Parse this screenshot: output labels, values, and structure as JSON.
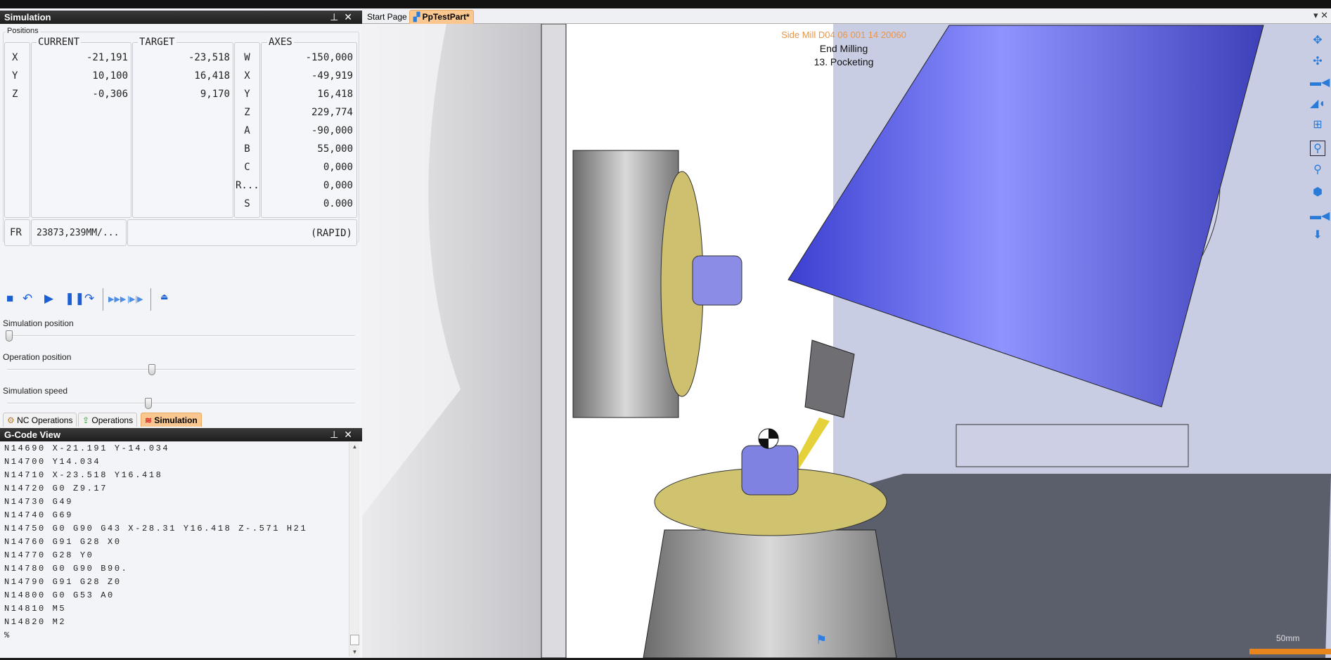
{
  "simulation_panel": {
    "title": "Simulation",
    "pin_icon": "pin-icon",
    "close_icon": "close-icon",
    "positions_label": "Positions",
    "current_header": "CURRENT",
    "target_header": "TARGET",
    "axes_header": "AXES",
    "rows": [
      {
        "axis": "X",
        "current": "-21,191",
        "target": "-23,518"
      },
      {
        "axis": "Y",
        "current": "10,100",
        "target": "16,418"
      },
      {
        "axis": "Z",
        "current": "-0,306",
        "target": "9,170"
      }
    ],
    "machine_axes": [
      {
        "axis": "W",
        "value": "-150,000"
      },
      {
        "axis": "X",
        "value": "-49,919"
      },
      {
        "axis": "Y",
        "value": "16,418"
      },
      {
        "axis": "Z",
        "value": "229,774"
      },
      {
        "axis": "A",
        "value": "-90,000"
      },
      {
        "axis": "B",
        "value": "55,000"
      },
      {
        "axis": "C",
        "value": "0,000"
      },
      {
        "axis": "R...",
        "value": "0,000"
      },
      {
        "axis": "S",
        "value": "0.000"
      }
    ],
    "fr_label": "FR",
    "fr_value": "23873,239MM/...",
    "motion_mode": "(RAPID)",
    "toolbar": [
      "stop-icon",
      "step-back-icon",
      "play-icon",
      "pause-icon",
      "step-forward-icon",
      "fast-forward-icon",
      "next-operation-icon",
      "eject-icon"
    ],
    "sliders": [
      {
        "label": "Simulation position",
        "value": 0.0
      },
      {
        "label": "Operation position",
        "value": 0.41
      },
      {
        "label": "Simulation speed",
        "value": 0.4
      }
    ],
    "tabs": [
      {
        "label": "NC Operations",
        "active": false
      },
      {
        "label": "Operations",
        "active": false
      },
      {
        "label": "Simulation",
        "active": true
      }
    ]
  },
  "gcode_panel": {
    "title": "G-Code View",
    "lines": [
      "N14690 X-21.191 Y-14.034",
      "N14700 Y14.034",
      "N14710 X-23.518 Y16.418",
      "N14720 G0 Z9.17",
      "N14730 G49",
      "N14740 G69",
      "N14750 G0 G90 G43 X-28.31 Y16.418 Z-.571 H21",
      "N14760 G91 G28 X0",
      "N14770 G28 Y0",
      "N14780 G0 G90 B90.",
      "N14790 G91 G28 Z0",
      "N14800 G0 G53 A0",
      "N14810 M5",
      "N14820 M2",
      "%"
    ]
  },
  "document_tabs": [
    {
      "label": "Start Page",
      "active": false
    },
    {
      "label": "PpTestPart*",
      "active": true
    }
  ],
  "viewport": {
    "tool_label": "Side Mill D04 06 001 14 20060",
    "operation_type": "End Milling",
    "operation_name": "13. Pocketing",
    "scale_label": "50mm",
    "right_toolbar": [
      "pan-icon",
      "rotate-icon",
      "camera-icon",
      "camera-tilt-icon",
      "split-view-icon",
      "zoom-window-icon",
      "zoom-icon",
      "view-cube-icon",
      "camera-front-icon",
      "export-icon"
    ],
    "colors": {
      "accent_tab": "#f9c78f",
      "tool_label": "#e8954a",
      "spindle": "#5a5ef0",
      "scale_bar": "#e8861e"
    }
  }
}
